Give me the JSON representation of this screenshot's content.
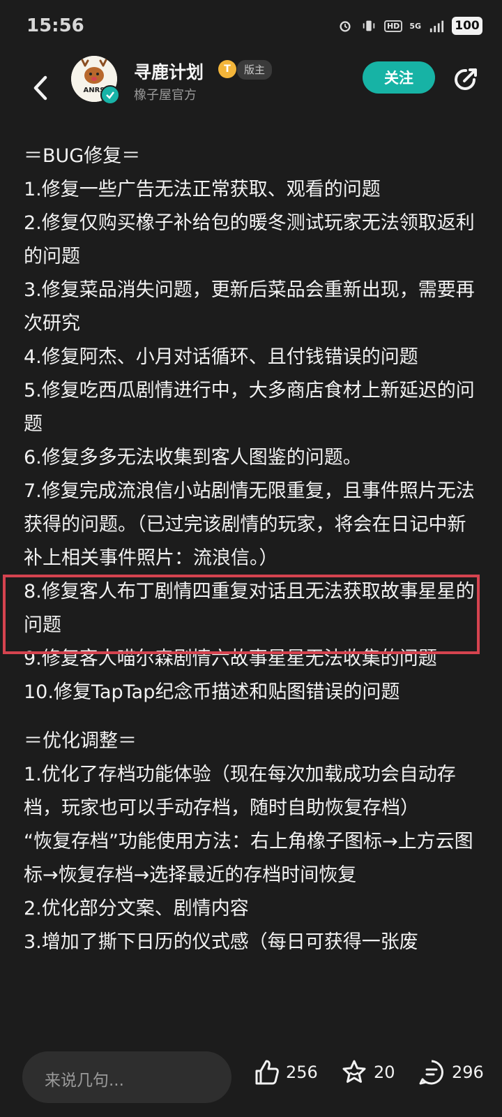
{
  "status_bar": {
    "time": "15:56",
    "network_hd": "HD",
    "network_gen": "5G",
    "battery": "100"
  },
  "header": {
    "author_name": "寻鹿计划",
    "level_badge": "T",
    "role_badge": "版主",
    "subtitle": "橡子屋官方",
    "follow_label": "关注",
    "avatar_text": "ANRS"
  },
  "post": {
    "bug_section_title": "＝BUG修复＝",
    "bug_items": [
      "1.修复一些广告无法正常获取、观看的问题",
      "2.修复仅购买橡子补给包的暖冬测试玩家无法领取返利的问题",
      "3.修复菜品消失问题，更新后菜品会重新出现，需要再次研究",
      "4.修复阿杰、小月对话循环、且付钱错误的问题",
      "5.修复吃西瓜剧情进行中，大多商店食材上新延迟的问题",
      "6.修复多多无法收集到客人图鉴的问题。",
      "7.修复完成流浪信小站剧情无限重复，且事件照片无法获得的问题。（已过完该剧情的玩家，将会在日记中新补上相关事件照片：流浪信。）",
      "8.修复客人布丁剧情四重复对话且无法获取故事星星的问题",
      "9.修复客人喵尔森剧情六故事星星无法收集的问题",
      "10.修复TapTap纪念币描述和贴图错误的问题"
    ],
    "opt_section_title": "＝优化调整＝",
    "opt_items": [
      "1.优化了存档功能体验（现在每次加载成功会自动存档，玩家也可以手动存档，随时自助恢复存档）",
      "“恢复存档”功能使用方法：右上角橡子图标→上方云图标→恢复存档→选择最近的存档时间恢复",
      "2.优化部分文案、剧情内容",
      "3.增加了撕下日历的仪式感（每日可获得一张废"
    ]
  },
  "bottom_bar": {
    "comment_placeholder": "来说几句...",
    "likes": "256",
    "favorites": "20",
    "comments": "296"
  },
  "colors": {
    "background": "#1c1c1c",
    "accent": "#17b3a5",
    "highlight": "#d5434f"
  }
}
